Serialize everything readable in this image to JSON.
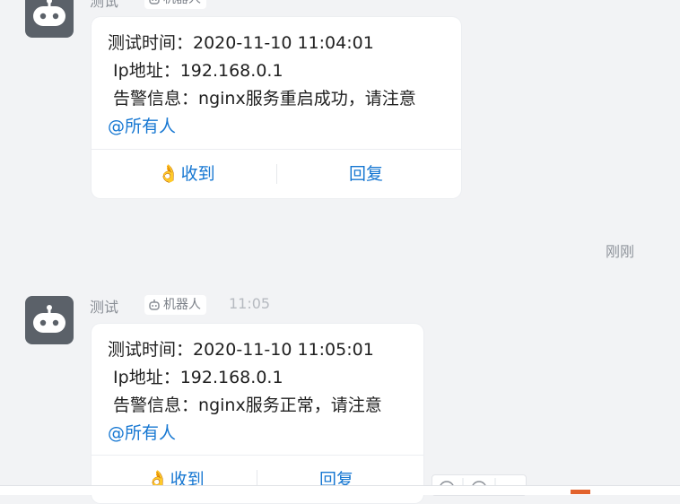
{
  "messages": [
    {
      "sender": "测试",
      "bot_tag": "机器人",
      "time": "",
      "lines": [
        "测试时间：2020-11-10 11:04:01",
        " Ip地址：192.168.0.1",
        " 告警信息：nginx服务重启成功，请注意"
      ],
      "mention": "@所有人",
      "actions": {
        "ack": "收到",
        "reply": "回复"
      }
    },
    {
      "sender": "测试",
      "bot_tag": "机器人",
      "time": "11:05",
      "lines": [
        "测试时间：2020-11-10 11:05:01",
        " Ip地址：192.168.0.1",
        " 告警信息：nginx服务正常，请注意"
      ],
      "mention": "@所有人",
      "actions": {
        "ack": "收到",
        "reply": "回复"
      }
    }
  ],
  "read_stamp": "刚刚",
  "icons": {
    "avatar": "robot-icon",
    "bot_tag": "robot-tag-icon",
    "ack": "ok-hand-icon"
  },
  "colors": {
    "link": "#1677d2",
    "avatar_bg": "#5b6169",
    "background": "#f2f3f5"
  }
}
